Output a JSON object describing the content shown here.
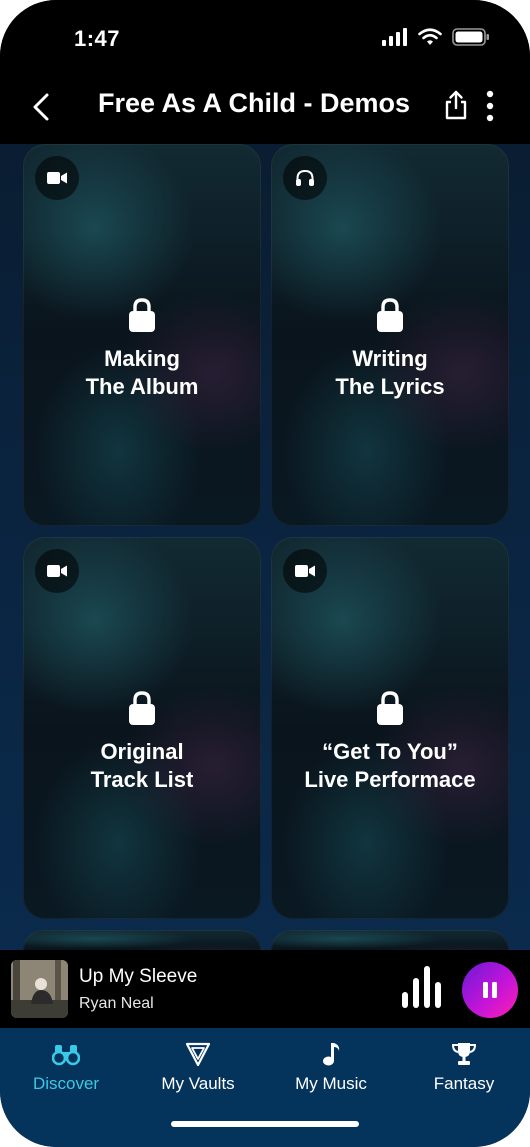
{
  "status_bar": {
    "time": "1:47",
    "icons": [
      "signal-icon",
      "wifi-icon",
      "battery-icon"
    ]
  },
  "header": {
    "title": "Free As A Child - Demos",
    "icons": [
      "back-icon",
      "share-icon",
      "more-icon"
    ]
  },
  "cards": [
    {
      "line1": "Making",
      "line2": "The Album",
      "type_icon": "video-icon",
      "locked": true
    },
    {
      "line1": "Writing",
      "line2": "The Lyrics",
      "type_icon": "headphones-icon",
      "locked": true
    },
    {
      "line1": "Original",
      "line2": "Track List",
      "type_icon": "video-icon",
      "locked": true
    },
    {
      "line1": "“Get To You”",
      "line2": "Live Performace",
      "type_icon": "video-icon",
      "locked": true
    }
  ],
  "now_playing": {
    "title": "Up My Sleeve",
    "artist": "Ryan Neal",
    "icons": [
      "equalizer-icon",
      "pause-icon"
    ]
  },
  "tabs": [
    {
      "label": "Discover",
      "icon": "binoculars-icon",
      "active": true
    },
    {
      "label": "My Vaults",
      "icon": "vault-icon",
      "active": false
    },
    {
      "label": "My Music",
      "icon": "music-note-icon",
      "active": false
    },
    {
      "label": "Fantasy",
      "icon": "trophy-icon",
      "active": false
    }
  ],
  "colors": {
    "accent": "#3ac9e6",
    "tab_bar": "#04335c",
    "play_gradient_start": "#6a1bd6",
    "play_gradient_end": "#ff1fb4"
  }
}
